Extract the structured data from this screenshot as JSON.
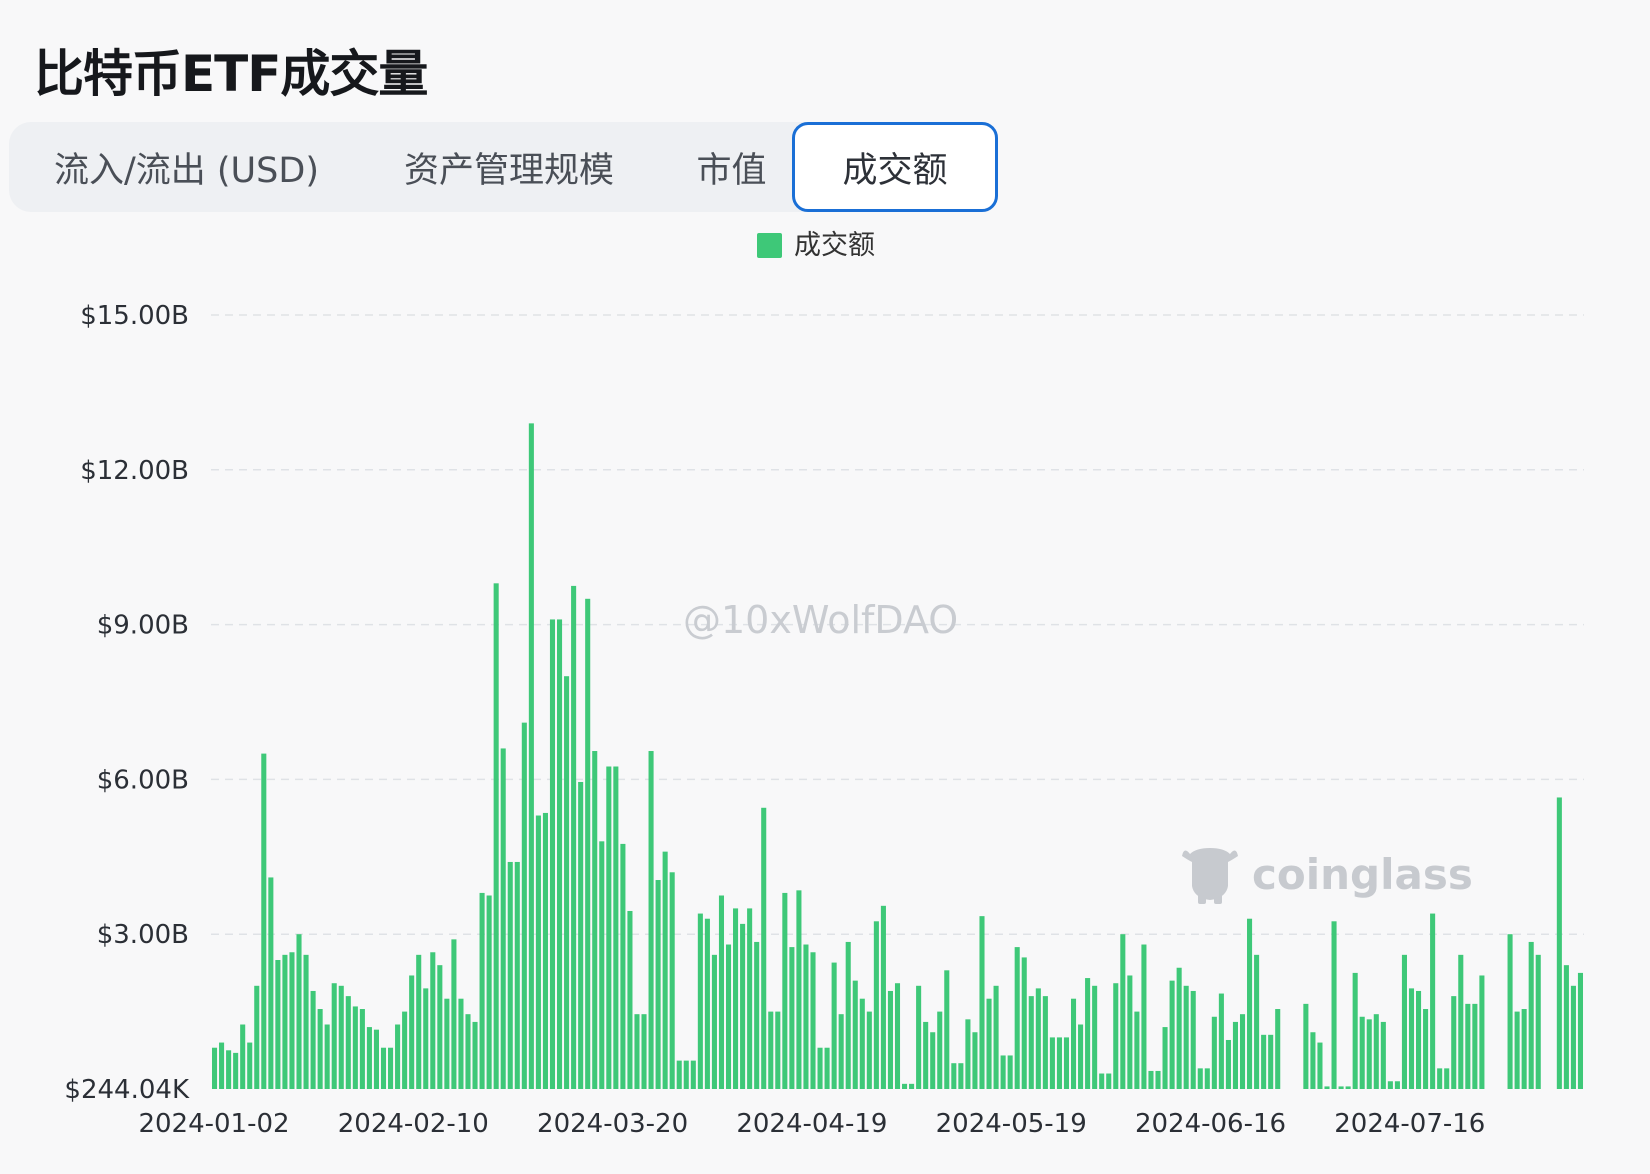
{
  "page": {
    "title": "比特币ETF成交量"
  },
  "tabs": [
    {
      "label": "流入/流出 (USD)",
      "active": false
    },
    {
      "label": "资产管理规模",
      "active": false
    },
    {
      "label": "市值",
      "active": false
    },
    {
      "label": "成交额",
      "active": true
    }
  ],
  "watermark": {
    "handle": "@10xWolfDAO",
    "brand": "coinglass"
  },
  "colors": {
    "bar": "#3ec878",
    "accent": "#1a6fd6",
    "grid": "#dfe2e6"
  },
  "chart_data": {
    "type": "bar",
    "legend": {
      "label": "成交额",
      "position": "top-center"
    },
    "y_ticks": [
      "$244.04K",
      "$3.00B",
      "$6.00B",
      "$9.00B",
      "$12.00B",
      "$15.00B"
    ],
    "x_ticks": [
      "2024-01-02",
      "2024-02-10",
      "2024-03-20",
      "2024-04-19",
      "2024-05-19",
      "2024-06-16",
      "2024-07-16"
    ],
    "ylim": [
      0,
      15
    ],
    "y_unit": "B USD",
    "grid": true,
    "values": [
      0.8,
      0.9,
      0.75,
      0.7,
      1.25,
      0.9,
      2.0,
      6.5,
      4.1,
      2.5,
      2.6,
      2.65,
      3.0,
      2.6,
      1.9,
      1.55,
      1.25,
      2.05,
      2.0,
      1.8,
      1.6,
      1.55,
      1.2,
      1.15,
      0.8,
      0.8,
      1.25,
      1.5,
      2.2,
      2.6,
      1.95,
      2.65,
      2.4,
      1.75,
      2.9,
      1.75,
      1.45,
      1.3,
      3.8,
      3.75,
      9.8,
      6.6,
      4.4,
      4.4,
      7.1,
      12.9,
      5.3,
      5.35,
      9.1,
      9.1,
      8.0,
      9.75,
      5.95,
      9.5,
      6.55,
      4.8,
      6.25,
      6.25,
      4.75,
      3.45,
      1.45,
      1.45,
      6.55,
      4.05,
      4.6,
      4.2,
      0.55,
      0.55,
      0.55,
      3.4,
      3.3,
      2.6,
      3.75,
      2.8,
      3.5,
      3.2,
      3.5,
      2.85,
      5.45,
      1.5,
      1.5,
      3.8,
      2.75,
      3.85,
      2.8,
      2.65,
      0.8,
      0.8,
      2.45,
      1.45,
      2.85,
      2.1,
      1.75,
      1.5,
      3.25,
      3.55,
      1.9,
      2.05,
      0.1,
      0.1,
      2.0,
      1.3,
      1.1,
      1.5,
      2.3,
      0.5,
      0.5,
      1.35,
      1.1,
      3.35,
      1.75,
      2.0,
      0.65,
      0.65,
      2.75,
      2.55,
      1.8,
      1.95,
      1.8,
      1.0,
      1.0,
      1.0,
      1.75,
      1.25,
      2.15,
      2.0,
      0.3,
      0.3,
      2.05,
      3.0,
      2.2,
      1.5,
      2.8,
      0.35,
      0.35,
      1.2,
      2.1,
      2.35,
      2.0,
      1.9,
      0.4,
      0.4,
      1.4,
      1.85,
      0.95,
      1.3,
      1.45,
      3.3,
      2.6,
      1.05,
      1.05,
      1.55,
      0.0,
      0.0,
      0.0,
      1.65,
      1.1,
      0.9,
      0.05,
      3.25,
      0.05,
      0.05,
      2.25,
      1.4,
      1.35,
      1.45,
      1.3,
      0.15,
      0.15,
      2.6,
      1.95,
      1.9,
      1.55,
      3.4,
      0.4,
      0.4,
      1.8,
      2.6,
      1.65,
      1.65,
      2.2,
      0.0,
      0.0,
      0.0,
      3.0,
      1.5,
      1.55,
      2.85,
      2.6,
      0.0,
      0.0,
      5.65,
      2.4,
      2.0,
      2.25
    ]
  }
}
